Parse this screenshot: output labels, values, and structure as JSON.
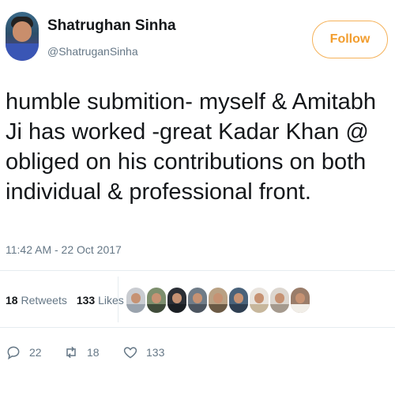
{
  "user": {
    "display_name": "Shatrughan Sinha",
    "handle": "@ShatruganSinha",
    "avatar_icon": "profile-photo"
  },
  "follow_button": {
    "label": "Follow",
    "color": "#f29d2e"
  },
  "tweet": {
    "text": "humble submition- myself & Amitabh Ji has worked -great Kadar Khan @ obliged on his contributions on both individual & professional front.",
    "timestamp": "11:42 AM - 22 Oct 2017"
  },
  "stats": {
    "retweets_count": "18",
    "retweets_label": "Retweets",
    "likes_count": "133",
    "likes_label": "Likes"
  },
  "likers": [
    {
      "bg": "#c9ccd1",
      "shirt": "#9aa3ad"
    },
    {
      "bg": "#7d8f6e",
      "shirt": "#3f4b3a"
    },
    {
      "bg": "#2b2f36",
      "shirt": "#1b1f24"
    },
    {
      "bg": "#6f7c88",
      "shirt": "#4c5560"
    },
    {
      "bg": "#b9a184",
      "shirt": "#6b5a45"
    },
    {
      "bg": "#49627a",
      "shirt": "#2f3f52"
    },
    {
      "bg": "#e9e4de",
      "shirt": "#c7b79c"
    },
    {
      "bg": "#dcd6cf",
      "shirt": "#a59a8e"
    },
    {
      "bg": "#9a7d6a",
      "shirt": "#f1eee8"
    }
  ],
  "actions": {
    "reply_count": "22",
    "retweet_count": "18",
    "like_count": "133"
  }
}
